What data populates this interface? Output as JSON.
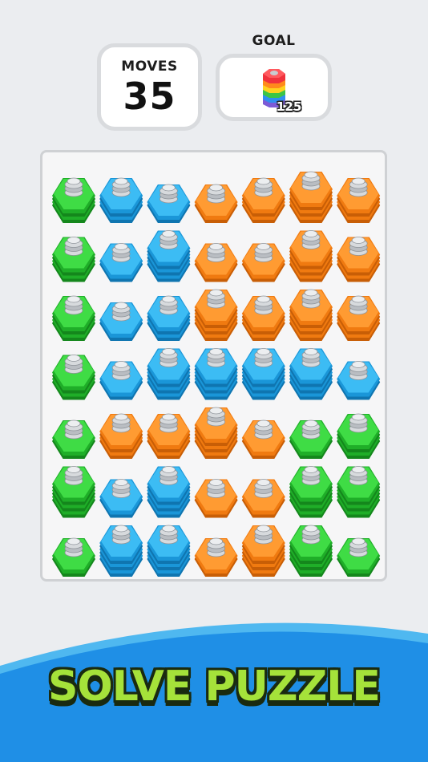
{
  "hud": {
    "moves_label": "MOVES",
    "moves_value": "35",
    "goal_label": "GOAL",
    "goal_count": "125"
  },
  "banner": {
    "text": "SOLVE PUZZLE"
  },
  "colors": {
    "green": "#22c52b",
    "blue": "#1fa8e8",
    "orange": "#ff8a1c",
    "banner_blue": "#1f8fe6"
  },
  "board": {
    "cols": 7,
    "rows": 7,
    "cells": [
      [
        {
          "c": "green",
          "h": 2
        },
        {
          "c": "blue",
          "h": 2
        },
        {
          "c": "blue",
          "h": 1
        },
        {
          "c": "orange",
          "h": 1
        },
        {
          "c": "orange",
          "h": 2
        },
        {
          "c": "orange",
          "h": 3
        },
        {
          "c": "orange",
          "h": 2
        }
      ],
      [
        {
          "c": "green",
          "h": 2
        },
        {
          "c": "blue",
          "h": 1
        },
        {
          "c": "blue",
          "h": 3
        },
        {
          "c": "orange",
          "h": 1
        },
        {
          "c": "orange",
          "h": 1
        },
        {
          "c": "orange",
          "h": 3
        },
        {
          "c": "orange",
          "h": 2
        }
      ],
      [
        {
          "c": "green",
          "h": 2
        },
        {
          "c": "blue",
          "h": 1
        },
        {
          "c": "blue",
          "h": 2
        },
        {
          "c": "orange",
          "h": 3
        },
        {
          "c": "orange",
          "h": 2
        },
        {
          "c": "orange",
          "h": 3
        },
        {
          "c": "orange",
          "h": 2
        }
      ],
      [
        {
          "c": "green",
          "h": 2
        },
        {
          "c": "blue",
          "h": 1
        },
        {
          "c": "blue",
          "h": 3
        },
        {
          "c": "blue",
          "h": 3
        },
        {
          "c": "blue",
          "h": 3
        },
        {
          "c": "blue",
          "h": 3
        },
        {
          "c": "blue",
          "h": 1
        }
      ],
      [
        {
          "c": "green",
          "h": 1
        },
        {
          "c": "orange",
          "h": 2
        },
        {
          "c": "orange",
          "h": 2
        },
        {
          "c": "orange",
          "h": 3
        },
        {
          "c": "orange",
          "h": 1
        },
        {
          "c": "green",
          "h": 1
        },
        {
          "c": "green",
          "h": 2
        }
      ],
      [
        {
          "c": "green",
          "h": 3
        },
        {
          "c": "blue",
          "h": 1
        },
        {
          "c": "blue",
          "h": 3
        },
        {
          "c": "orange",
          "h": 1
        },
        {
          "c": "orange",
          "h": 1
        },
        {
          "c": "green",
          "h": 3
        },
        {
          "c": "green",
          "h": 3
        }
      ],
      [
        {
          "c": "green",
          "h": 1
        },
        {
          "c": "blue",
          "h": 3
        },
        {
          "c": "blue",
          "h": 3
        },
        {
          "c": "orange",
          "h": 1
        },
        {
          "c": "orange",
          "h": 3
        },
        {
          "c": "green",
          "h": 3
        },
        {
          "c": "green",
          "h": 1
        }
      ]
    ]
  }
}
